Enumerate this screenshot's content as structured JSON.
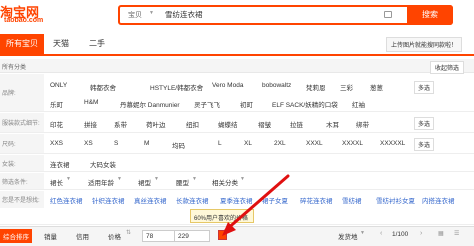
{
  "header": {
    "logo_main": "淘宝网",
    "logo_sub": "taobao.com",
    "search_category": "宝贝",
    "search_query": "雪纺连衣裙",
    "search_button": "搜索",
    "image_search_tip": "上传图片就能搜同款啦！"
  },
  "nav": {
    "tabs": [
      {
        "label": "所有宝贝"
      },
      {
        "label": "天猫"
      },
      {
        "label": "二手"
      }
    ]
  },
  "crumb": {
    "label": "所有分类",
    "collapse": "收起筛选"
  },
  "brand_row": {
    "label": "品牌:",
    "row1": [
      "ONLY",
      "韩都衣舍",
      "HSTYLE/韩都衣舍",
      "Vero Moda",
      "bobowaltz",
      "梵莉恩",
      "三彩",
      "葱葱"
    ],
    "row2": [
      "乐町",
      "H&M",
      "丹慕妮尔 Danmunier",
      "灵子飞飞",
      "初町",
      "ELF SACK/妖精的口袋",
      "红袖"
    ],
    "more": "多选"
  },
  "pattern_row": {
    "label": "服装款式细节:",
    "options": [
      "印花",
      "拼接",
      "系带",
      "荷叶边",
      "纽扣",
      "蝴蝶结",
      "褶皱",
      "拉链",
      "木耳",
      "绑带"
    ],
    "more": "多选"
  },
  "size_row": {
    "label": "尺码:",
    "options": [
      "XXS",
      "XS",
      "S",
      "M",
      "均码",
      "L",
      "XL",
      "2XL",
      "XXXL",
      "XXXXL",
      "XXXXXL"
    ],
    "more": "多选"
  },
  "gender_row": {
    "label": "女装:",
    "options": [
      "连衣裙",
      "大码女装"
    ]
  },
  "filter_row": {
    "label": "筛选条件:",
    "options": [
      "裙长",
      "适用年龄",
      "裙型",
      "腰型",
      "相关分类"
    ]
  },
  "related_row": {
    "label": "您是不是想找:",
    "options": [
      "红色连衣裙",
      "针织连衣裙",
      "真丝连衣裙",
      "长款连衣裙",
      "夏季连衣裙",
      "裙子女夏",
      "碎花连衣裙",
      "雪纺裙",
      "雪纺衬衫女夏",
      "内搭连衣裙"
    ]
  },
  "bottom": {
    "sort_default": "综合排序",
    "sort_sales": "销量",
    "sort_credit": "信用",
    "price_label": "价格",
    "price_min": "78",
    "price_max": "229",
    "tooltip": "60%用户喜欢的价格",
    "ship_from": "发货地",
    "page": "1/100"
  },
  "colors": {
    "accent": "#ff4400"
  }
}
